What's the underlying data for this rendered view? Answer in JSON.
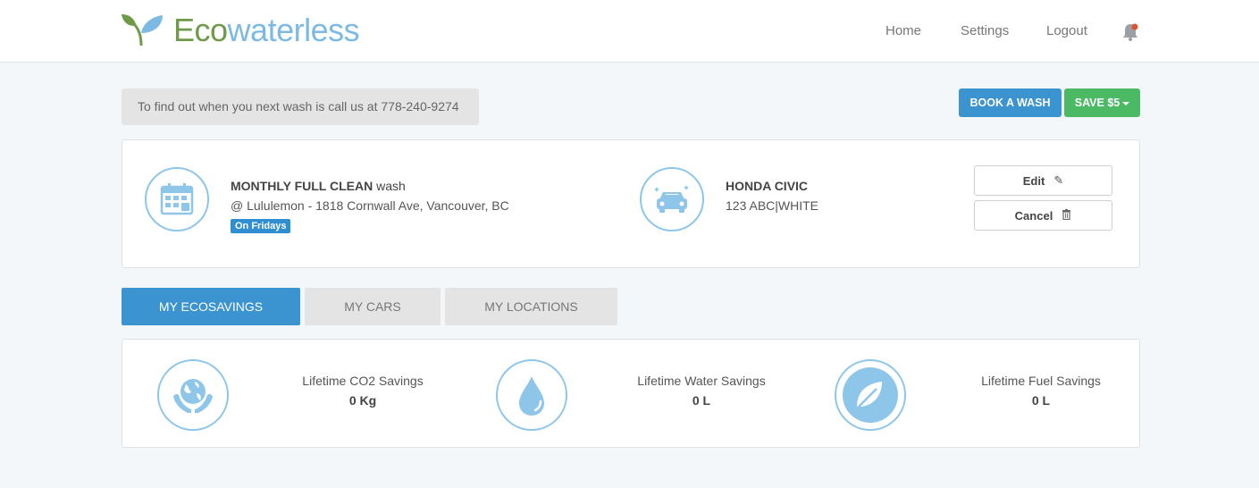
{
  "brand": {
    "eco": "Eco",
    "rest": "waterless",
    "colors": {
      "green": "#6f9a49",
      "blue": "#7cb9e3"
    }
  },
  "nav": {
    "home": "Home",
    "settings": "Settings",
    "logout": "Logout",
    "bell_icon": "bell-icon"
  },
  "info_bar": {
    "text": "To find out when you next wash is call us at 778-240-9274"
  },
  "actions": {
    "book": "BOOK A WASH",
    "save": "SAVE $5"
  },
  "wash": {
    "title_bold": "MONTHLY FULL CLEAN",
    "title_rest": " wash",
    "location": "@ Lululemon - 1818 Cornwall Ave, Vancouver, BC",
    "schedule_badge": "On Fridays",
    "car_name": "HONDA CIVIC",
    "car_plate": "123 ABC|WHITE",
    "edit_label": "Edit",
    "cancel_label": "Cancel"
  },
  "tabs": [
    {
      "label": "MY ECOSAVINGS",
      "active": true
    },
    {
      "label": "MY CARS",
      "active": false
    },
    {
      "label": "MY LOCATIONS",
      "active": false
    }
  ],
  "savings": [
    {
      "label": "Lifetime CO2 Savings",
      "value": "0 Kg",
      "icon": "globe-hands-icon"
    },
    {
      "label": "Lifetime Water Savings",
      "value": "0 L",
      "icon": "water-drop-icon"
    },
    {
      "label": "Lifetime Fuel Savings",
      "value": "0 L",
      "icon": "leaf-icon"
    }
  ],
  "colors": {
    "accent_blue": "#3b93d0",
    "accent_green": "#4cb964",
    "icon_blue": "#8ec6ea"
  }
}
